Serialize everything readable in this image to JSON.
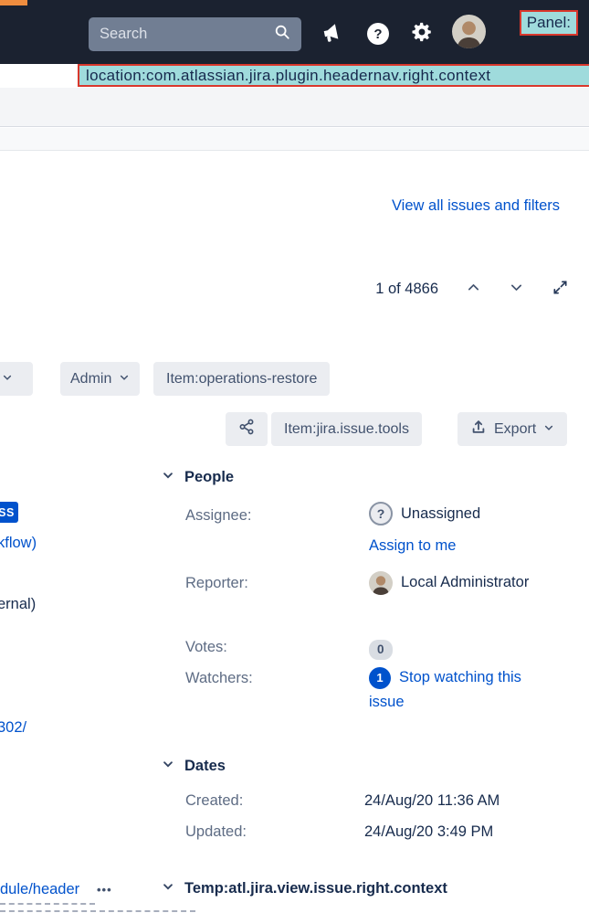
{
  "header": {
    "search_placeholder": "Search",
    "panel_label": "Panel:",
    "location_annotation": "location:com.atlassian.jira.plugin.headernav.right.context"
  },
  "glyphs": {
    "help": "?",
    "unassigned": "?",
    "more": "•••"
  },
  "issue_nav": {
    "view_all_link": "View all issues and filters",
    "pager_text": "1 of 4866"
  },
  "toolbar": {
    "admin_label": "Admin",
    "operations_restore_label": "Item:operations-restore",
    "issue_tools_label": "Item:jira.issue.tools",
    "export_label": "Export"
  },
  "left_fragments": {
    "status": "SS",
    "workflow": "kflow)",
    "internal": "ernal)",
    "url": "302/",
    "module": "dule/header"
  },
  "people": {
    "title": "People",
    "assignee_label": "Assignee:",
    "assignee_value": "Unassigned",
    "assign_to_me_link": "Assign to me",
    "reporter_label": "Reporter:",
    "reporter_value": "Local Administrator",
    "votes_label": "Votes:",
    "votes_value": "0",
    "watchers_label": "Watchers:",
    "watchers_count": "1",
    "stop_watching_link": "Stop watching this issue"
  },
  "dates": {
    "title": "Dates",
    "created_label": "Created:",
    "created_value": "24/Aug/20 11:36 AM",
    "updated_label": "Updated:",
    "updated_value": "24/Aug/20 3:49 PM"
  },
  "footer": {
    "temp_panel_title": "Temp:atl.jira.view.issue.right.context"
  },
  "colors": {
    "link": "#0052CC",
    "header_bg": "#1B2230",
    "annotation_bg": "#9FDBDC",
    "annotation_border": "#D9372C",
    "status_badge": "#0052CC"
  }
}
